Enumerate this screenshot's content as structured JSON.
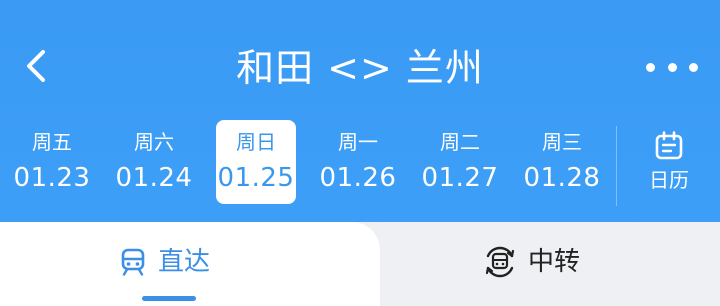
{
  "header": {
    "title": "和田 <> 兰州"
  },
  "date_strip": {
    "items": [
      {
        "weekday": "周五",
        "date": "01.23",
        "selected": false
      },
      {
        "weekday": "周六",
        "date": "01.24",
        "selected": false
      },
      {
        "weekday": "周日",
        "date": "01.25",
        "selected": true
      },
      {
        "weekday": "周一",
        "date": "01.26",
        "selected": false
      },
      {
        "weekday": "周二",
        "date": "01.27",
        "selected": false
      },
      {
        "weekday": "周三",
        "date": "01.28",
        "selected": false
      }
    ],
    "calendar_label": "日历"
  },
  "tabs": {
    "direct_label": "直达",
    "transfer_label": "中转",
    "active": "direct"
  },
  "colors": {
    "header_bg": "#3a9af4",
    "accent": "#3a8fe6",
    "tab_inactive_bg": "#eef0f3"
  },
  "icons": {
    "back": "chevron-left-icon",
    "more": "more-dots-icon",
    "calendar": "calendar-icon",
    "direct": "train-icon",
    "transfer": "transfer-train-icon"
  }
}
